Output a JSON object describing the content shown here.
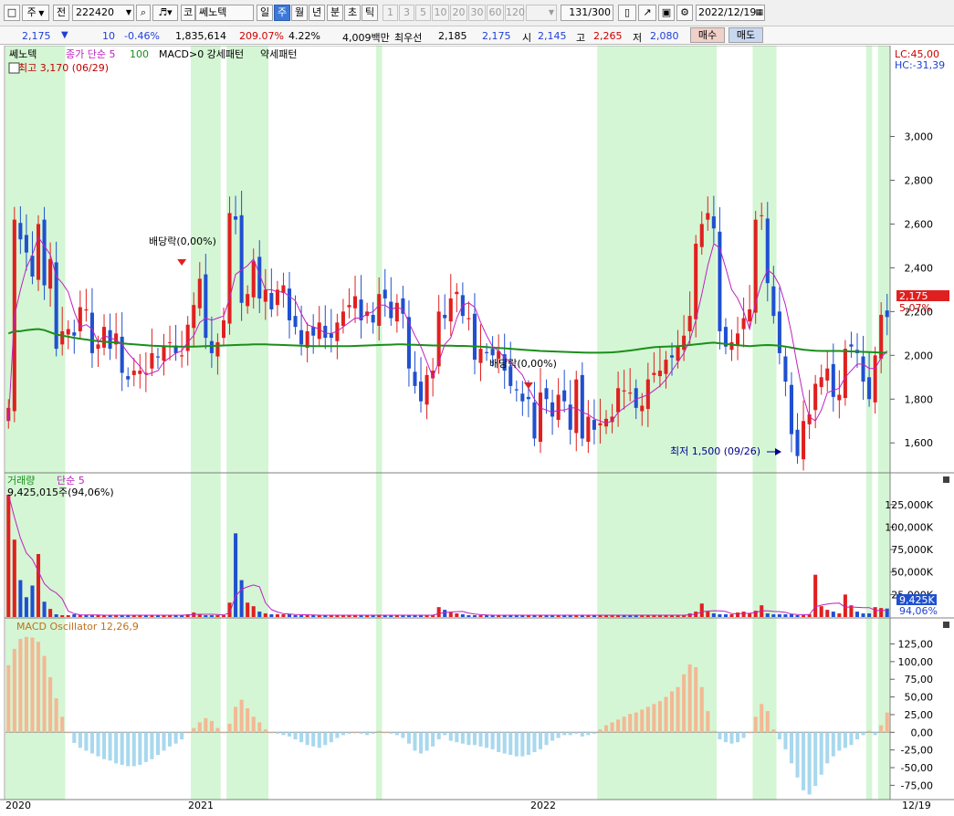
{
  "toolbar": {
    "period_sel": "주",
    "prev_label": "전",
    "code": "222420",
    "market": "코",
    "name": "쎄노텍",
    "tf": [
      "일",
      "주",
      "월",
      "년",
      "분",
      "초",
      "틱"
    ],
    "tf_selected": 1,
    "mins": [
      "1",
      "3",
      "5",
      "10",
      "20",
      "30",
      "60",
      "120"
    ],
    "count": "131",
    "count_max": "/300",
    "date": "2022/12/19"
  },
  "info": {
    "price": "2,175",
    "change": "10",
    "change_pct": "-0.46%",
    "volume": "1,835,614",
    "vol_ratio": "209.07%",
    "turnover": "4.22%",
    "amount": "4,009백만",
    "best_label": "최우선",
    "best_ask": "2,185",
    "best_bid": "2,175",
    "open_label": "시",
    "open": "2,145",
    "high_label": "고",
    "high": "2,265",
    "low_label": "저",
    "low": "2,080",
    "buy_label": "매수",
    "sell_label": "매도"
  },
  "chart_data": [
    {
      "type": "candlestick",
      "legend": [
        "쎄노텍",
        "종가 단순 5",
        "100",
        "MACD>0 강세패턴",
        "약세패턴"
      ],
      "lc": "LC:45,00",
      "hc": "HC:-31,39",
      "price_tag": "2,175",
      "pct_tag": "5,07%",
      "ylim": [
        1480,
        3340
      ],
      "yticks": [
        1600,
        1800,
        2000,
        2200,
        2400,
        2600,
        2800,
        3000
      ],
      "ytick_labels": [
        "1,600",
        "1,800",
        "2,000",
        "2,200",
        "2,400",
        "2,600",
        "2,800",
        "3,000"
      ],
      "annotations": {
        "max": "최고 3,170 (06/29)",
        "min": "최저 1,500 (09/26)",
        "dividend1": "배당락(0,00%)",
        "dividend2": "배당락(0,00%)"
      },
      "close": [
        1760,
        2620,
        2530,
        2470,
        2360,
        2600,
        2320,
        2440,
        2030,
        2110,
        2120,
        2090,
        2220,
        2210,
        2010,
        2050,
        2130,
        2030,
        2100,
        1920,
        1890,
        1930,
        1930,
        1920,
        2010,
        1990,
        2040,
        2060,
        2010,
        2000,
        2140,
        2230,
        2350,
        2080,
        2010,
        2060,
        2160,
        2650,
        2620,
        2240,
        2280,
        2430,
        2260,
        2300,
        2210,
        2300,
        2320,
        2160,
        2130,
        2050,
        2110,
        2090,
        2150,
        2080,
        2080,
        2150,
        2200,
        2230,
        2270,
        2160,
        2200,
        2150,
        2280,
        2260,
        2170,
        2240,
        2190,
        1940,
        1860,
        1790,
        1910,
        1930,
        2200,
        2170,
        2260,
        2290,
        2180,
        2170,
        1980,
        2030,
        2010,
        2000,
        2020,
        1930,
        1860,
        1840,
        1790,
        1800,
        1620,
        1830,
        1800,
        1720,
        1820,
        1790,
        1660,
        1890,
        1620,
        1720,
        1660,
        1690,
        1710,
        1720,
        1850,
        1840,
        1830,
        1760,
        1770,
        1890,
        1920,
        1930,
        1980,
        1990,
        2040,
        2090,
        2180,
        2510,
        2600,
        2650,
        2580,
        2110,
        2040,
        2060,
        2100,
        2170,
        2210,
        2620,
        2640,
        2330,
        2180,
        2010,
        1880,
        1640,
        1540,
        1700,
        1730,
        1870,
        1900,
        1940,
        1810,
        1820,
        2030,
        2040,
        2010,
        1880,
        1800,
        2000,
        2185,
        2175
      ],
      "sma5": [
        1700,
        2180,
        2300,
        2400,
        2460,
        2540,
        2500,
        2460,
        2360,
        2330,
        2290,
        2200,
        2130,
        2140,
        2120,
        2060,
        2090,
        2080,
        2070,
        2050,
        2010,
        1980,
        1950,
        1910,
        1920,
        1930,
        1970,
        1990,
        2010,
        2020,
        2060,
        2090,
        2150,
        2170,
        2160,
        2170,
        2180,
        2260,
        2370,
        2390,
        2410,
        2440,
        2370,
        2300,
        2300,
        2290,
        2290,
        2270,
        2250,
        2190,
        2140,
        2130,
        2120,
        2100,
        2100,
        2110,
        2130,
        2150,
        2170,
        2170,
        2190,
        2200,
        2230,
        2230,
        2210,
        2220,
        2210,
        2150,
        2090,
        2040,
        1970,
        1900,
        1970,
        2050,
        2080,
        2170,
        2230,
        2240,
        2220,
        2150,
        2090,
        2040,
        2020,
        1990,
        1970,
        1940,
        1910,
        1850,
        1800,
        1760,
        1750,
        1740,
        1750,
        1750,
        1760,
        1760,
        1740,
        1730,
        1710,
        1700,
        1690,
        1700,
        1740,
        1760,
        1780,
        1800,
        1810,
        1820,
        1840,
        1860,
        1890,
        1930,
        1970,
        2010,
        2070,
        2160,
        2280,
        2410,
        2510,
        2490,
        2400,
        2300,
        2260,
        2200,
        2120,
        2240,
        2330,
        2390,
        2370,
        2320,
        2230,
        2100,
        1950,
        1810,
        1720,
        1700,
        1750,
        1830,
        1840,
        1850,
        1900,
        1930,
        1960,
        1960,
        1940,
        1940,
        1990,
        2020
      ],
      "ma100": [
        2100,
        2110,
        2110,
        2115,
        2118,
        2120,
        2115,
        2105,
        2095,
        2090,
        2085,
        2080,
        2076,
        2072,
        2068,
        2065,
        2062,
        2060,
        2058,
        2055,
        2052,
        2050,
        2048,
        2046,
        2044,
        2043,
        2042,
        2041,
        2040,
        2040,
        2040,
        2040,
        2041,
        2042,
        2043,
        2044,
        2045,
        2046,
        2047,
        2048,
        2049,
        2050,
        2050,
        2050,
        2049,
        2048,
        2047,
        2046,
        2045,
        2044,
        2043,
        2042,
        2042,
        2042,
        2042,
        2042,
        2042,
        2042,
        2043,
        2044,
        2045,
        2046,
        2047,
        2048,
        2049,
        2050,
        2050,
        2049,
        2048,
        2047,
        2046,
        2045,
        2045,
        2044,
        2044,
        2043,
        2043,
        2042,
        2041,
        2040,
        2038,
        2036,
        2034,
        2032,
        2030,
        2028,
        2026,
        2024,
        2022,
        2020,
        2019,
        2018,
        2017,
        2016,
        2015,
        2014,
        2013,
        2012,
        2012,
        2012,
        2013,
        2014,
        2016,
        2019,
        2022,
        2026,
        2030,
        2034,
        2037,
        2039,
        2040,
        2041,
        2042,
        2044,
        2047,
        2050,
        2053,
        2056,
        2058,
        2055,
        2052,
        2049,
        2046,
        2044,
        2042,
        2044,
        2046,
        2047,
        2046,
        2044,
        2040,
        2035,
        2030,
        2026,
        2023,
        2021,
        2020,
        2020,
        2020,
        2020,
        2019,
        2018,
        2017,
        2016,
        2015,
        2014,
        2012,
        2012
      ]
    },
    {
      "type": "bar",
      "legend": [
        "거래량",
        "단순 5"
      ],
      "last_label": "9,425,015주(94,06%)",
      "tag_value": "9,425K",
      "tag_pct": "94,06%",
      "ylim": [
        0,
        140000
      ],
      "yticks": [
        25000,
        50000,
        75000,
        100000,
        125000
      ],
      "ytick_labels": [
        "25,000K",
        "50,000K",
        "75,000K",
        "100,000K",
        "125,000K"
      ],
      "volume": [
        136000,
        86000,
        41000,
        22000,
        35000,
        70000,
        17000,
        9000,
        3000,
        2000,
        2000,
        3000,
        2000,
        2000,
        2000,
        2000,
        2000,
        2000,
        2000,
        2000,
        2000,
        2000,
        2000,
        2000,
        2000,
        2000,
        2000,
        2000,
        2000,
        2000,
        3000,
        5000,
        3000,
        2000,
        2000,
        2000,
        2000,
        16000,
        93000,
        41000,
        16000,
        12000,
        6000,
        4000,
        3000,
        3000,
        3000,
        3000,
        2000,
        2000,
        2000,
        2000,
        2000,
        2000,
        2000,
        2000,
        2000,
        2000,
        2000,
        2000,
        2000,
        2000,
        2000,
        2000,
        2000,
        2000,
        2000,
        2000,
        2000,
        2000,
        2000,
        2000,
        11000,
        8000,
        5000,
        4000,
        3000,
        2000,
        2000,
        2000,
        2000,
        2000,
        2000,
        2000,
        2000,
        2000,
        2000,
        2000,
        2000,
        2000,
        2000,
        2000,
        2000,
        2000,
        2000,
        2000,
        2000,
        2000,
        2000,
        2000,
        2000,
        2000,
        2000,
        2000,
        2000,
        2000,
        2000,
        2000,
        2000,
        2000,
        2000,
        2000,
        2000,
        2000,
        4000,
        6000,
        15000,
        6000,
        4000,
        3000,
        3000,
        3000,
        5000,
        6000,
        4000,
        7000,
        13000,
        4000,
        3000,
        3000,
        3000,
        3000,
        2000,
        2000,
        3000,
        47000,
        12000,
        8000,
        6000,
        4000,
        25000,
        13000,
        6000,
        4000,
        4000,
        11000,
        10000,
        9425
      ]
    },
    {
      "type": "bar",
      "legend": [
        "MACD Oscillator 12,26,9"
      ],
      "ylim": [
        -90,
        145
      ],
      "yticks": [
        -75,
        -50,
        -25,
        0,
        25,
        50,
        75,
        100,
        125
      ],
      "ytick_labels": [
        "-75,00",
        "-50,00",
        "-25,00",
        "0,00",
        "25,00",
        "50,00",
        "75,00",
        "100,00",
        "125,00"
      ],
      "macd": [
        95,
        118,
        132,
        135,
        134,
        128,
        108,
        78,
        48,
        22,
        0,
        -15,
        -22,
        -26,
        -30,
        -34,
        -38,
        -40,
        -44,
        -46,
        -48,
        -48,
        -46,
        -42,
        -38,
        -32,
        -26,
        -20,
        -16,
        -10,
        0,
        6,
        14,
        20,
        16,
        6,
        0,
        12,
        36,
        46,
        34,
        22,
        14,
        4,
        0,
        -2,
        -4,
        -6,
        -10,
        -14,
        -18,
        -20,
        -22,
        -18,
        -14,
        -8,
        -4,
        -2,
        0,
        -2,
        -4,
        -2,
        2,
        0,
        -2,
        -4,
        -8,
        -16,
        -26,
        -30,
        -26,
        -20,
        -10,
        -4,
        -12,
        -14,
        -16,
        -18,
        -18,
        -20,
        -22,
        -24,
        -28,
        -30,
        -32,
        -34,
        -34,
        -32,
        -28,
        -24,
        -18,
        -12,
        -8,
        -4,
        -4,
        -2,
        -6,
        -4,
        -2,
        4,
        10,
        14,
        18,
        22,
        26,
        28,
        32,
        36,
        40,
        44,
        50,
        58,
        64,
        82,
        96,
        92,
        64,
        30,
        2,
        -10,
        -14,
        -16,
        -14,
        -8,
        0,
        22,
        40,
        30,
        4,
        -10,
        -24,
        -44,
        -64,
        -82,
        -88,
        -76,
        -60,
        -44,
        -34,
        -26,
        -22,
        -18,
        -10,
        -4,
        2,
        -4,
        10,
        28
      ]
    }
  ],
  "x_labels": [
    "2020",
    "2021",
    "2022",
    "12/19"
  ]
}
